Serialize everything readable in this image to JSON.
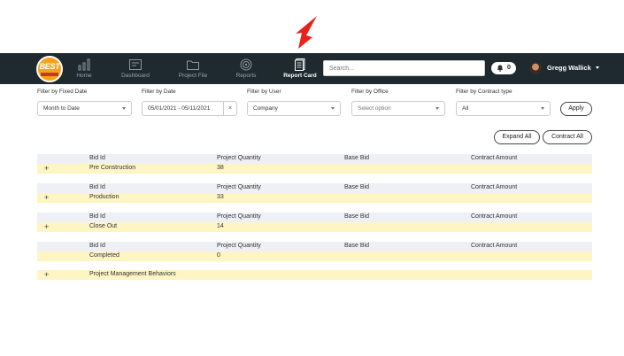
{
  "annotation": {
    "arrow_color": "#e8211a"
  },
  "logo": {
    "text": "BEST"
  },
  "nav": {
    "items": [
      {
        "label": "Home",
        "icon": "bar-chart-icon"
      },
      {
        "label": "Dashboard",
        "icon": "dashboard-icon"
      },
      {
        "label": "Project File",
        "icon": "folder-icon"
      },
      {
        "label": "Reports",
        "icon": "target-icon"
      },
      {
        "label": "Report Card",
        "icon": "report-card-icon"
      }
    ],
    "search_placeholder": "Search...",
    "notification_count": "0",
    "user_name": "Gregg Wallick"
  },
  "filters": {
    "fixed_date": {
      "label": "Filter by Fixed Date",
      "value": "Month to Date"
    },
    "date": {
      "label": "Filter by Date",
      "value": "05/01/2021 - 05/11/2021",
      "clear": "×"
    },
    "user": {
      "label": "Filter by User",
      "value": "Company"
    },
    "office": {
      "label": "Filter by Office",
      "value": "Select option"
    },
    "contract_type": {
      "label": "Filter by Contract type",
      "value": "All"
    },
    "apply_label": "Apply"
  },
  "actions": {
    "expand_all": "Expand All",
    "contract_all": "Contract All"
  },
  "table": {
    "headers": {
      "bid_id": "Bid Id",
      "project_quantity": "Project Quantity",
      "base_bid": "Base Bid",
      "contract_amount": "Contract Amount"
    },
    "groups": [
      {
        "expander": "+",
        "name": "Pre Construction",
        "quantity": "38"
      },
      {
        "expander": "+",
        "name": "Production",
        "quantity": "33"
      },
      {
        "expander": "+",
        "name": "Close Out",
        "quantity": "14"
      },
      {
        "expander": "",
        "name": "Completed",
        "quantity": "0"
      }
    ],
    "behaviors": {
      "expander": "+",
      "name": "Project Management Behaviors"
    }
  },
  "colors": {
    "navbar": "#1e2a2f",
    "header_row": "#eef0f6",
    "data_row": "#fdf5c4",
    "logo": "#f7a21b"
  }
}
